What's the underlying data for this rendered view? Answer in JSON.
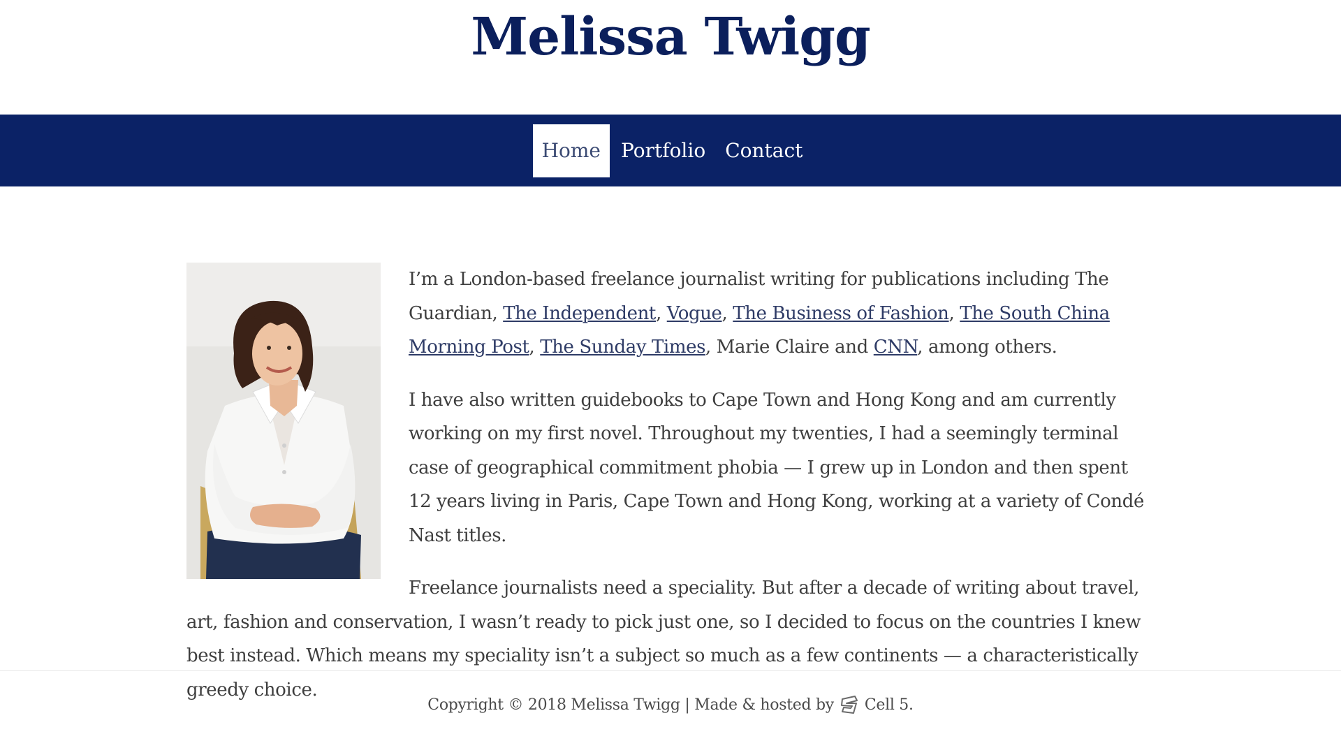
{
  "site": {
    "title": "Melissa Twigg"
  },
  "nav": {
    "items": [
      {
        "label": "Home",
        "active": true
      },
      {
        "label": "Portfolio",
        "active": false
      },
      {
        "label": "Contact",
        "active": false
      }
    ]
  },
  "image": {
    "icon": "portrait-photo"
  },
  "intro": {
    "p1_text1": "I’m a London-based freelance journalist writing for publications including The Guardian, ",
    "link_independent": "The Independent",
    "sep1": ", ",
    "link_vogue": "Vogue",
    "sep2": ", ",
    "link_bof": "The Business of Fashion",
    "sep3": ", ",
    "link_scmp": "The South China Morning Post",
    "sep4": ", ",
    "link_sunday_times": "The Sunday Times",
    "p1_text2": ", Marie Claire and ",
    "link_cnn": "CNN",
    "p1_text3": ", among others.",
    "p2": "I have also written guidebooks to Cape Town and Hong Kong and am currently working on my first novel. Throughout my twenties, I had a seemingly terminal case of geographical commitment phobia — I grew up in London and then spent 12 years living in Paris, Cape Town and Hong Kong, working at a variety of Condé Nast titles.",
    "p3": "Freelance journalists need a speciality. But after a decade of writing about travel, art, fashion and conservation, I wasn’t ready to pick just one, so I decided to focus on the countries I knew best instead. Which means my speciality isn’t a subject so much as a few continents — a characteristically greedy choice."
  },
  "footer": {
    "copyright": "Copyright © 2018 Melissa Twigg | Made & hosted by",
    "brand": "Cell 5.",
    "brand_icon": "cell5-logo-icon"
  },
  "colors": {
    "brand_navy": "#0b2266",
    "title_navy": "#0b1f5c",
    "body_text": "#3e3e3e"
  }
}
